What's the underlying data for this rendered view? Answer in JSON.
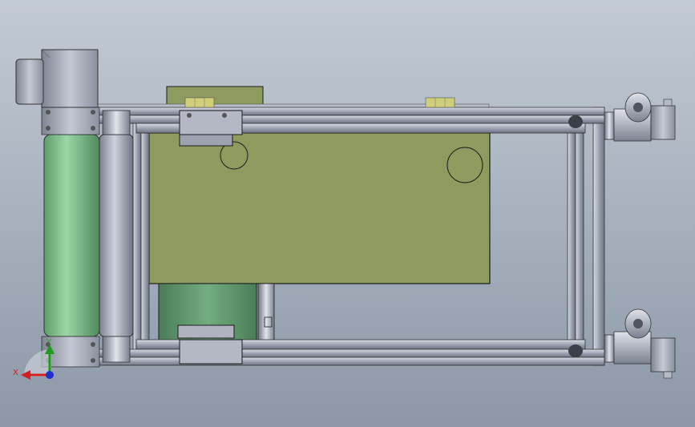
{
  "viewport": {
    "background_top": "#c3cad3",
    "background_bottom": "#8c98a8"
  },
  "colors": {
    "frame_metal": "#a9afbd",
    "frame_dark": "#6f7584",
    "plate_olive": "#8e9b5e",
    "plate_olive_dark": "#7a8750",
    "drive_roller_green": "#7cbf8a",
    "inner_green": "#5c9a6c",
    "motor_grey": "#a0a6b4",
    "hinge_gold": "#cfcf7a",
    "outline": "#1c1c1c"
  },
  "triad": {
    "x_label": "X",
    "y_label": "Y",
    "x_color": "#d42020",
    "y_color": "#1f9a1f",
    "z_color": "#2030d0"
  },
  "icons": {
    "triad": "coordinate-triad-icon"
  }
}
